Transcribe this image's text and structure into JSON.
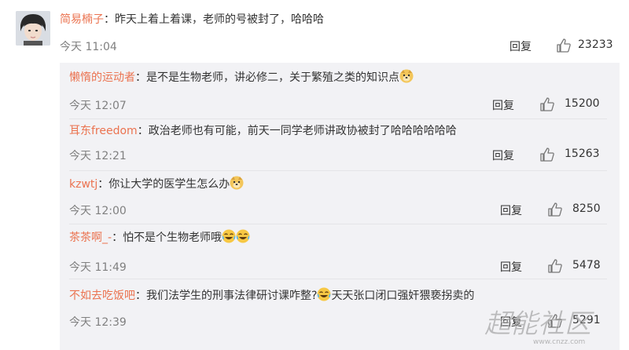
{
  "colors": {
    "username": "#eb7350",
    "time": "#808080",
    "text": "#333333",
    "sub_bg": "#f2f2f5"
  },
  "main": {
    "username": "简易楠子",
    "separator": "：",
    "text": "昨天上着上着课，老师的号被封了，哈哈哈",
    "time": "今天 11:04",
    "reply_label": "回复",
    "likes": "23233"
  },
  "subs": [
    {
      "username": "懒惰的运动者",
      "separator": "：",
      "text": "是不是生物老师，讲必修二，关于繁殖之类的知识点",
      "emoji": "doge",
      "time": "今天 12:07",
      "reply_label": "回复",
      "likes": "15200"
    },
    {
      "username": "耳东freedom",
      "separator": "：",
      "text": "政治老师也有可能，前天一同学老师讲政协被封了哈哈哈哈哈哈",
      "emoji": "",
      "time": "今天 12:21",
      "reply_label": "回复",
      "likes": "15263"
    },
    {
      "username": "kzwtj",
      "separator": "：",
      "text": "你让大学的医学生怎么办",
      "emoji": "doge",
      "time": "今天 12:00",
      "reply_label": "回复",
      "likes": "8250"
    },
    {
      "username": "茶茶啊_-",
      "separator": "：",
      "text": "怕不是个生物老师哦",
      "emoji": "laugh-cry-2",
      "time": "今天 11:49",
      "reply_label": "回复",
      "likes": "5478"
    },
    {
      "username": "不如去吃饭吧",
      "separator": "：",
      "text": "我们法学生的刑事法律研讨课咋整?",
      "text_after": "天天张口闭口强奸猥亵拐卖的",
      "emoji": "laugh-cry",
      "time": "今天 12:39",
      "reply_label": "回复",
      "likes": "5291"
    }
  ],
  "watermark": {
    "text": "超能社区",
    "url": "www.cnzz.com"
  }
}
